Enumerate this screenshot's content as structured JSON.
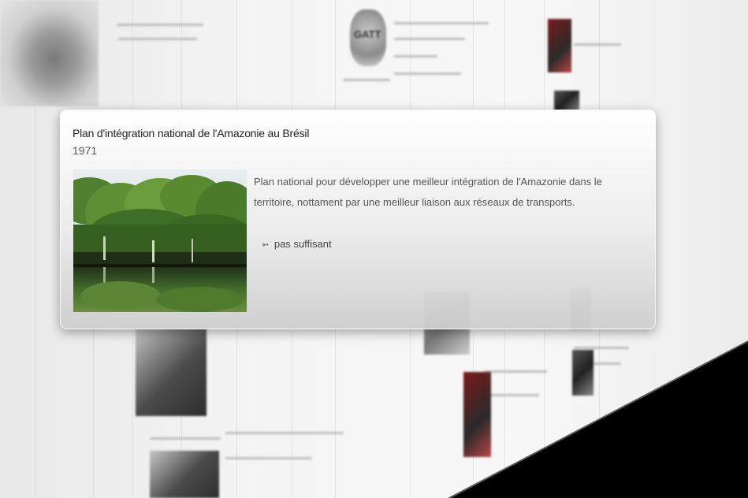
{
  "popup": {
    "title": "Plan d'intégration national de l'Amazonie au Brésil",
    "year": "1971",
    "description": "Plan national pour développer une meilleur intégration de l'Amazonie dans le territoire, nottament par une meilleur liaison aux réseaux de transports.",
    "link_icon": "double-arrow-icon",
    "link_symbol": "➳",
    "link_label": "pas suffisant",
    "image": "amazon-forest-river-reflection-photo"
  },
  "background": {
    "gatt_logo_text": "GATT",
    "colors": {
      "wedge": "#000000",
      "card_top": "#ffffff",
      "card_bottom": "#cdcdcd"
    }
  }
}
